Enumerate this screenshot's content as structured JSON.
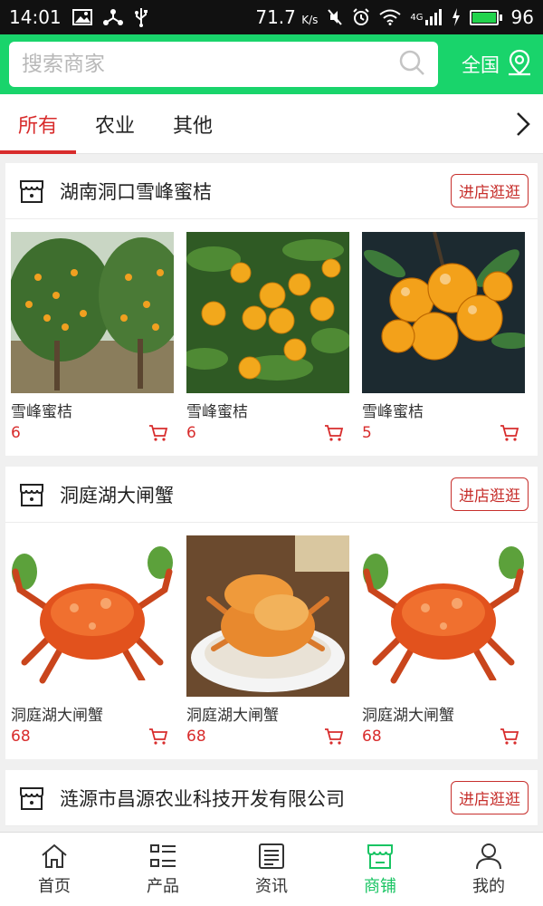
{
  "status_bar": {
    "time": "14:01",
    "net_speed": "71.7",
    "net_unit": "K/s",
    "signal_label": "4G",
    "battery": "96"
  },
  "search": {
    "placeholder": "搜索商家",
    "region": "全国"
  },
  "tabs": [
    {
      "label": "所有",
      "active": true
    },
    {
      "label": "农业",
      "active": false
    },
    {
      "label": "其他",
      "active": false
    }
  ],
  "shops": [
    {
      "name": "湖南洞口雪峰蜜桔",
      "visit_label": "进店逛逛",
      "products": [
        {
          "name": "雪峰蜜桔",
          "price": "6"
        },
        {
          "name": "雪峰蜜桔",
          "price": "6"
        },
        {
          "name": "雪峰蜜桔",
          "price": "5"
        }
      ]
    },
    {
      "name": "洞庭湖大闸蟹",
      "visit_label": "进店逛逛",
      "products": [
        {
          "name": "洞庭湖大闸蟹",
          "price": "68"
        },
        {
          "name": "洞庭湖大闸蟹",
          "price": "68"
        },
        {
          "name": "洞庭湖大闸蟹",
          "price": "68"
        }
      ]
    },
    {
      "name": "涟源市昌源农业科技开发有限公司",
      "visit_label": "进店逛逛",
      "products": []
    }
  ],
  "bottom_nav": [
    {
      "label": "首页",
      "icon": "home-icon",
      "active": false
    },
    {
      "label": "产品",
      "icon": "list-icon",
      "active": false
    },
    {
      "label": "资讯",
      "icon": "news-icon",
      "active": false
    },
    {
      "label": "商铺",
      "icon": "shop-icon",
      "active": true
    },
    {
      "label": "我的",
      "icon": "user-icon",
      "active": false
    }
  ],
  "colors": {
    "brand_green": "#19d46b",
    "accent_red": "#d82c2c"
  }
}
